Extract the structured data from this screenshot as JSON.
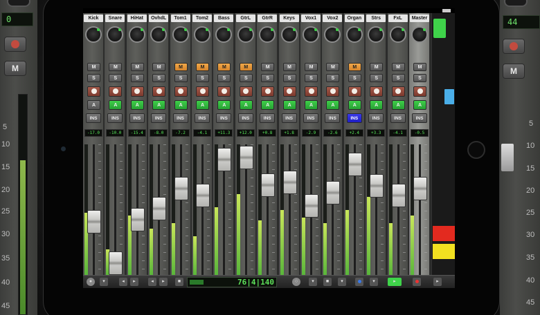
{
  "background_left": {
    "display_value": "0",
    "mute_label": "M",
    "scale": [
      "5",
      "10",
      "15",
      "20",
      "25",
      "30",
      "35",
      "40",
      "45"
    ]
  },
  "background_right": {
    "display_value": "44",
    "mute_label": "M",
    "scale": [
      "5",
      "10",
      "15",
      "20",
      "25",
      "30",
      "35",
      "40",
      "45"
    ]
  },
  "mixer": {
    "strips": [
      {
        "name": "Kick",
        "mute_on": false,
        "auto_on": false,
        "ins_on": false,
        "value": "-17.0"
      },
      {
        "name": "Snare",
        "mute_on": false,
        "auto_on": true,
        "ins_on": false,
        "value": "-10.0"
      },
      {
        "name": "HiHat",
        "mute_on": false,
        "auto_on": true,
        "ins_on": false,
        "value": "-15.4"
      },
      {
        "name": "OvhdL",
        "mute_on": false,
        "auto_on": true,
        "ins_on": false,
        "value": "-8.0"
      },
      {
        "name": "Tom1",
        "mute_on": true,
        "auto_on": true,
        "ins_on": false,
        "value": "-7.2"
      },
      {
        "name": "Tom2",
        "mute_on": true,
        "auto_on": true,
        "ins_on": false,
        "value": "-4.1"
      },
      {
        "name": "Bass",
        "mute_on": true,
        "auto_on": true,
        "ins_on": false,
        "value": "+11.3"
      },
      {
        "name": "GtrL",
        "mute_on": true,
        "auto_on": true,
        "ins_on": false,
        "value": "+12.0"
      },
      {
        "name": "GtrR",
        "mute_on": false,
        "auto_on": true,
        "ins_on": false,
        "value": "+0.8"
      },
      {
        "name": "Keys",
        "mute_on": false,
        "auto_on": true,
        "ins_on": false,
        "value": "+1.8"
      },
      {
        "name": "Vox1",
        "mute_on": false,
        "auto_on": true,
        "ins_on": false,
        "value": "-2.9"
      },
      {
        "name": "Vox2",
        "mute_on": false,
        "auto_on": true,
        "ins_on": false,
        "value": "-2.6"
      },
      {
        "name": "Organ",
        "mute_on": true,
        "auto_on": true,
        "ins_on": true,
        "value": "+2.4"
      },
      {
        "name": "Strs",
        "mute_on": false,
        "auto_on": true,
        "ins_on": false,
        "value": "+3.3"
      },
      {
        "name": "FxL",
        "mute_on": false,
        "auto_on": true,
        "ins_on": false,
        "value": "-4.1"
      },
      {
        "name": "Master",
        "mute_on": false,
        "auto_on": true,
        "ins_on": false,
        "value": "-0.5"
      }
    ],
    "labels": {
      "mute": "M",
      "solo": "S",
      "auto": "A",
      "ins": "INS"
    }
  },
  "transport": {
    "counter": "76|4|140"
  },
  "colors": {
    "green": "#3fd34a",
    "orange": "#e3952f",
    "blue": "#2424d8",
    "red": "#e32a1f",
    "yellow": "#f2e020"
  }
}
